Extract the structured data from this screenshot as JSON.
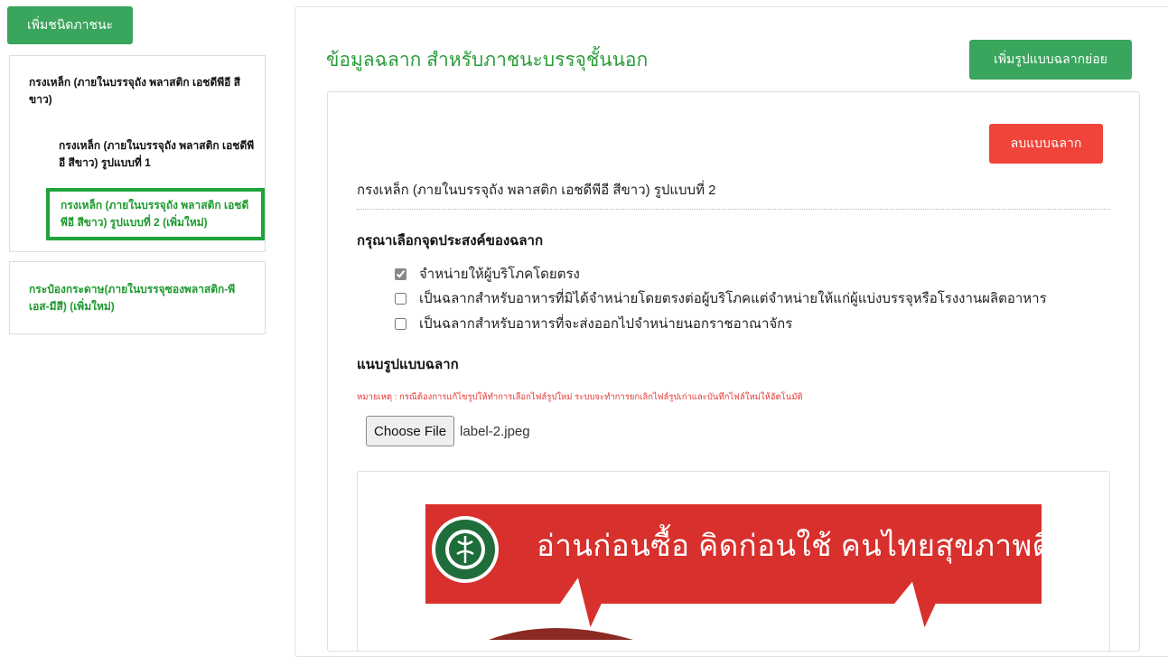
{
  "sidebar": {
    "add_type_label": "เพิ่มชนิดภาชนะ",
    "group1_title": "กรงเหล็ก (ภายในบรรจุถัง พลาสติก เอชดีพีอี สีขาว)",
    "group1_items": [
      "กรงเหล็ก (ภายในบรรจุถัง พลาสติก เอชดีพีอี สีขาว) รูปแบบที่ 1",
      "กรงเหล็ก (ภายในบรรจุถัง พลาสติก เอชดีพีอี สีขาว) รูปแบบที่ 2 (เพิ่มใหม่)"
    ],
    "group2_title": "กระป๋องกระดาษ(ภายในบรรจุซองพลาสติก-พีเอส-มีสี) (เพิ่มใหม่)"
  },
  "main": {
    "title": "ข้อมูลฉลาก สำหรับภาชนะบรรจุชั้นนอก",
    "add_sub_label": "เพิ่มรูปแบบฉลากย่อย",
    "delete_label": "ลบแบบฉลาก",
    "variant_title": "กรงเหล็ก (ภายในบรรจุถัง พลาสติก เอชดีพีอี สีขาว)  รูปแบบที่ 2",
    "purpose_label": "กรุณาเลือกจุดประสงค์ของฉลาก",
    "options": [
      {
        "label": "จำหน่ายให้ผู้บริโภคโดยตรง",
        "checked": true
      },
      {
        "label": "เป็นฉลากสำหรับอาหารที่มิได้จำหน่ายโดยตรงต่อผู้บริโภคแต่จำหน่ายให้แก่ผู้แบ่งบรรจุหรือโรงงานผลิตอาหาร",
        "checked": false
      },
      {
        "label": "เป็นฉลากสำหรับอาหารที่จะส่งออกไปจำหน่ายนอกราชอาณาจักร",
        "checked": false
      }
    ],
    "attach_label": "แนบรูปแบบฉลาก",
    "note": "หมายเหตุ : กรณีต้องการแก้ไขรูปให้ทำการเลือกไฟล์รูปใหม่ ระบบจะทำการยกเลิกไฟล์รูปเก่าและบันทึกไฟล์ใหม่ให้อัตโนมัติ",
    "choose_file_label": "Choose File",
    "file_name": "label-2.jpeg",
    "preview_slogan": "อ่านก่อนซื้อ  คิดก่อนใช้  คนไทยสุขภาพดี"
  },
  "colors": {
    "accent_green": "#3aa55d",
    "title_green": "#2a9d3b",
    "danger_red": "#f0433a",
    "banner_red": "#d8302d"
  }
}
